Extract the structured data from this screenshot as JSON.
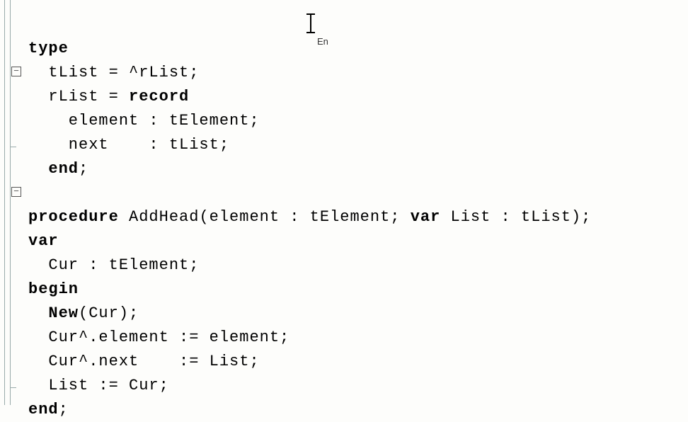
{
  "keywords": {
    "type": "type",
    "record": "record",
    "end1": "end",
    "procedure": "procedure",
    "var": "var",
    "begin": "begin",
    "New": "New",
    "end2": "end"
  },
  "lines": {
    "l2": "  tList = ^rList;",
    "l3a": "  rList = ",
    "l4": "    element : tElement;",
    "l5": "    next    : tList;",
    "l6b": ";",
    "l8b": " AddHead(element : tElement; ",
    "l8c": "var",
    "l8d": " List : tList);",
    "l10": "  Cur : tElement;",
    "l12a": "  ",
    "l12b": "(Cur);",
    "l13": "  Cur^.element := element;",
    "l14": "  Cur^.next    := List;",
    "l15": "  List := Cur;",
    "l16b": ";"
  },
  "overlay": {
    "lang": "En"
  },
  "gutter": {
    "fold_minus": "−"
  },
  "chart_data": null
}
